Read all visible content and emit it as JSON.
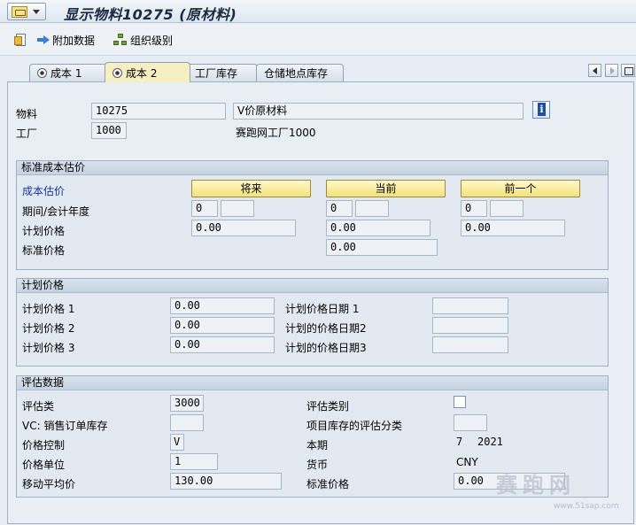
{
  "window": {
    "title": "显示物料10275 (原材料)"
  },
  "toolbar": {
    "attach_label": "附加数据",
    "org_label": "组织级别"
  },
  "tabs": [
    {
      "label": "成本 1",
      "has_radio": true
    },
    {
      "label": "成本 2",
      "has_radio": true,
      "active": true
    },
    {
      "label": "工厂库存",
      "has_radio": false
    },
    {
      "label": "仓储地点库存",
      "has_radio": false
    }
  ],
  "header": {
    "material_label": "物料",
    "material_value": "10275",
    "material_desc": "V价原材料",
    "plant_label": "工厂",
    "plant_value": "1000",
    "plant_desc": "赛跑网工厂1000"
  },
  "std_cost": {
    "title": "标准成本估价",
    "cost_est_label": "成本估价",
    "btn_future": "将来",
    "btn_current": "当前",
    "btn_previous": "前一个",
    "period_label": "期间/会计年度",
    "future_period": "0",
    "future_year": "",
    "current_period": "0",
    "current_year": "",
    "prev_period": "0",
    "prev_year": "",
    "planned_price_label": "计划价格",
    "future_planned": "0.00",
    "current_planned": "0.00",
    "prev_planned": "0.00",
    "standard_price_label": "标准价格",
    "current_standard": "0.00"
  },
  "planned": {
    "title": "计划价格",
    "p1_label": "计划价格 1",
    "p1_value": "0.00",
    "p2_label": "计划价格 2",
    "p2_value": "0.00",
    "p3_label": "计划价格 3",
    "p3_value": "0.00",
    "d1_label": "计划价格日期 1",
    "d1_value": "",
    "d2_label": "计划的价格日期2",
    "d2_value": "",
    "d3_label": "计划的价格日期3",
    "d3_value": ""
  },
  "valuation": {
    "title": "评估数据",
    "class_label": "评估类",
    "class_value": "3000",
    "category_label": "评估类别",
    "category_value": "",
    "vc_label": "VC: 销售订单库存",
    "vc_value": "",
    "project_label": "项目库存的评估分类",
    "project_value": "",
    "price_control_label": "价格控制",
    "price_control_value": "V",
    "period_label": "本期",
    "period_month": "7",
    "period_year": "2021",
    "unit_label": "价格单位",
    "unit_value": "1",
    "currency_label": "货币",
    "currency_value": "CNY",
    "map_label": "移动平均价",
    "map_value": "130.00",
    "std_price_label": "标准价格",
    "std_price_value": "0.00"
  },
  "watermark": {
    "main": "赛跑网",
    "sub": "www.51sap.com"
  }
}
